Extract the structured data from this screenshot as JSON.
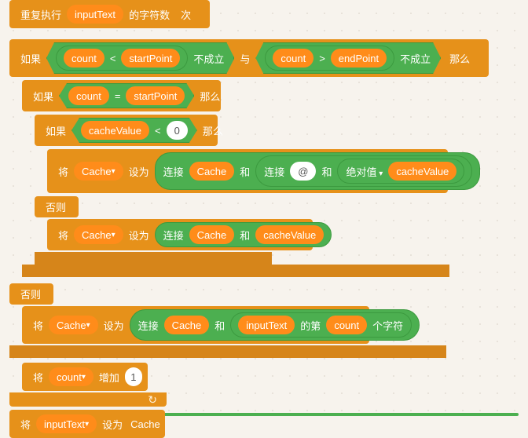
{
  "repeat": {
    "label_left": "重复执行",
    "var": "inputText",
    "label_mid": "的字符数",
    "label_right": "次"
  },
  "if1": {
    "label_if": "如果",
    "cond1": {
      "a": "count",
      "op": "<",
      "b": "startPoint",
      "suffix": "不成立"
    },
    "conj": "与",
    "cond2": {
      "a": "count",
      "op": ">",
      "b": "endPoint",
      "suffix": "不成立"
    },
    "label_then": "那么"
  },
  "if2": {
    "label_if": "如果",
    "cond": {
      "a": "count",
      "op": "=",
      "b": "startPoint"
    },
    "label_then": "那么"
  },
  "if3": {
    "label_if": "如果",
    "cond": {
      "a": "cacheValue",
      "op": "<",
      "b": "0"
    },
    "label_then": "那么"
  },
  "set1": {
    "label_set": "将",
    "var": "Cache",
    "label_to": "设为",
    "join1": "连接",
    "p1": "Cache",
    "and1": "和",
    "join2": "连接",
    "p2": "@",
    "and2": "和",
    "fn": "绝对值",
    "p3": "cacheValue"
  },
  "else1": {
    "label": "否则"
  },
  "set2": {
    "label_set": "将",
    "var": "Cache",
    "label_to": "设为",
    "join": "连接",
    "p1": "Cache",
    "and": "和",
    "p2": "cacheValue"
  },
  "else2": {
    "label": "否则"
  },
  "set3": {
    "label_set": "将",
    "var": "Cache",
    "label_to": "设为",
    "join": "连接",
    "p1": "Cache",
    "and": "和",
    "p2": "inputText",
    "mid": "的第",
    "p3": "count",
    "suffix": "个字符"
  },
  "inc": {
    "label_set": "将",
    "var": "count",
    "label_action": "增加",
    "val": "1"
  },
  "set4": {
    "label_set": "将",
    "var": "inputText",
    "label_to": "设为",
    "val": "Cache"
  }
}
